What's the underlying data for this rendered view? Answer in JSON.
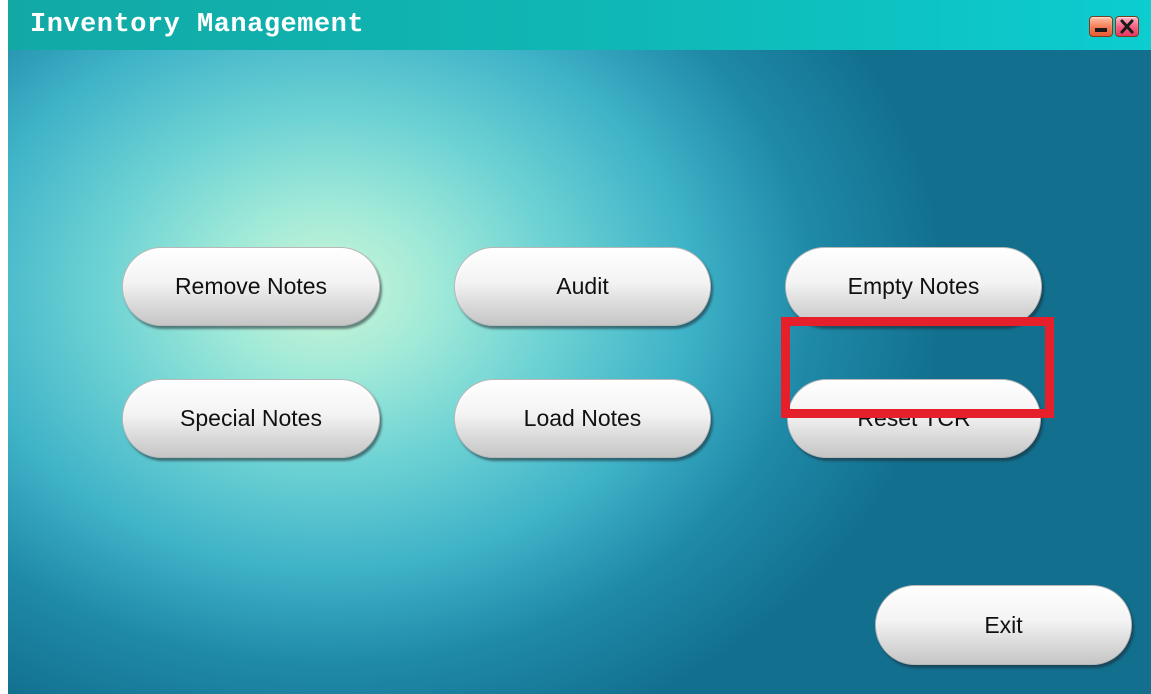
{
  "window": {
    "title": "Inventory Management",
    "minimize_icon": "minimize-icon",
    "close_icon": "close-icon"
  },
  "buttons": {
    "remove_notes": "Remove Notes",
    "audit": "Audit",
    "empty_notes": "Empty Notes",
    "special_notes": "Special Notes",
    "load_notes": "Load Notes",
    "reset_tcr": "Reset TCR",
    "exit": "Exit"
  },
  "highlight": {
    "target": "reset-tcr-button",
    "color": "#e5202a"
  },
  "colors": {
    "titlebar": "#12a9a5",
    "background_center": "#cdf6d6",
    "background_edge": "#126f8e"
  }
}
